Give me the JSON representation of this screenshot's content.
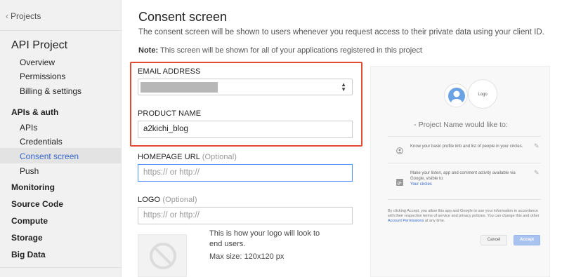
{
  "sidebar": {
    "back_label": "Projects",
    "project_title": "API Project",
    "project_items": [
      "Overview",
      "Permissions",
      "Billing & settings"
    ],
    "apis_section": "APIs & auth",
    "apis_items": [
      "APIs",
      "Credentials",
      "Consent screen",
      "Push"
    ],
    "active_item": "Consent screen",
    "sections": [
      "Monitoring",
      "Source Code",
      "Compute",
      "Storage",
      "Big Data"
    ]
  },
  "main": {
    "title": "Consent screen",
    "description": "The consent screen will be shown to users whenever you request access to their private data using your client ID.",
    "note_label": "Note:",
    "note_text": " This screen will be shown for all of your applications registered in this project",
    "email_label": "EMAIL ADDRESS",
    "email_value": "",
    "product_label": "PRODUCT NAME",
    "product_value": "a2kichi_blog",
    "homepage_label": "HOMEPAGE URL",
    "homepage_optional": "(Optional)",
    "homepage_placeholder": "https:// or http://",
    "logo_label": "LOGO",
    "logo_optional": "(Optional)",
    "logo_placeholder": "https:// or http://",
    "logo_note": "This is how your logo will look to end users.",
    "logo_size": "Max size: 120x120 px"
  },
  "preview": {
    "logo_text": "Logo",
    "would_like": "- Project Name would like to:",
    "perm1": "Know your basic profile info and list of people in your circles.",
    "perm2": "Make your listen, app and comment activity available via Google, visible to:",
    "perm2_link": "Your circles",
    "legal_text": "By clicking Accept, you allow this app and Google to use your information in accordance with their respective terms of service and privacy policies. You can change this and other",
    "legal_link": "Account Permissions",
    "legal_end": "at any time.",
    "cancel_label": "Cancel",
    "accept_label": "Accept"
  },
  "colors": {
    "highlight": "#e24a33",
    "link": "#3366cc",
    "focus": "#4d90fe"
  }
}
